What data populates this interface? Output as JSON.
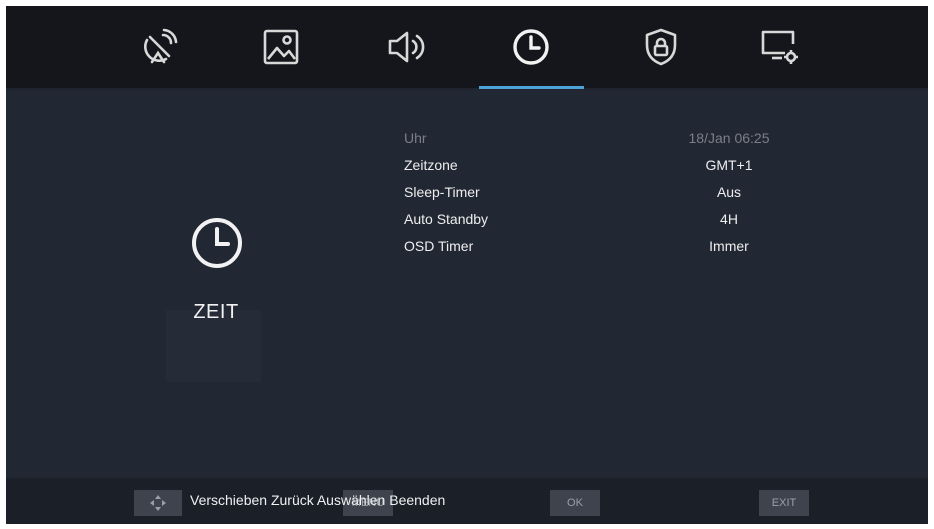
{
  "tabs": [
    {
      "name": "satellite-icon"
    },
    {
      "name": "picture-icon"
    },
    {
      "name": "sound-icon"
    },
    {
      "name": "clock-icon",
      "active": true
    },
    {
      "name": "lock-shield-icon"
    },
    {
      "name": "monitor-settings-icon"
    }
  ],
  "panel": {
    "title": "ZEIT",
    "icon": "clock-icon"
  },
  "settings": [
    {
      "label": "Uhr",
      "value": "18/Jan  06:25",
      "disabled": true
    },
    {
      "label": "Zeitzone",
      "value": "GMT+1"
    },
    {
      "label": "Sleep-Timer",
      "value": "Aus"
    },
    {
      "label": "Auto Standby",
      "value": "4H"
    },
    {
      "label": "OSD Timer",
      "value": "Immer"
    }
  ],
  "footer": {
    "hint": "Verschieben Zurück Auswählen Beenden",
    "menu_key": "MENU",
    "ok_key": "OK",
    "exit_key": "EXIT"
  },
  "colors": {
    "accent": "#4da3d6",
    "background": "#212733",
    "topbar": "#14161b"
  }
}
